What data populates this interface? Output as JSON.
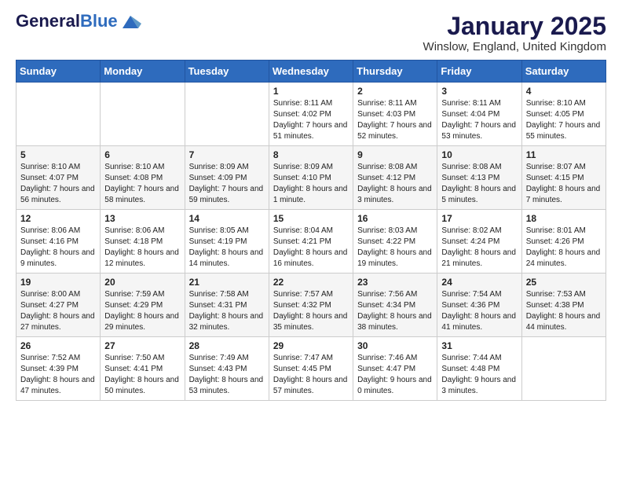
{
  "header": {
    "logo_general": "General",
    "logo_blue": "Blue",
    "month_title": "January 2025",
    "location": "Winslow, England, United Kingdom"
  },
  "weekdays": [
    "Sunday",
    "Monday",
    "Tuesday",
    "Wednesday",
    "Thursday",
    "Friday",
    "Saturday"
  ],
  "weeks": [
    [
      {
        "day": "",
        "info": ""
      },
      {
        "day": "",
        "info": ""
      },
      {
        "day": "",
        "info": ""
      },
      {
        "day": "1",
        "info": "Sunrise: 8:11 AM\nSunset: 4:02 PM\nDaylight: 7 hours and 51 minutes."
      },
      {
        "day": "2",
        "info": "Sunrise: 8:11 AM\nSunset: 4:03 PM\nDaylight: 7 hours and 52 minutes."
      },
      {
        "day": "3",
        "info": "Sunrise: 8:11 AM\nSunset: 4:04 PM\nDaylight: 7 hours and 53 minutes."
      },
      {
        "day": "4",
        "info": "Sunrise: 8:10 AM\nSunset: 4:05 PM\nDaylight: 7 hours and 55 minutes."
      }
    ],
    [
      {
        "day": "5",
        "info": "Sunrise: 8:10 AM\nSunset: 4:07 PM\nDaylight: 7 hours and 56 minutes."
      },
      {
        "day": "6",
        "info": "Sunrise: 8:10 AM\nSunset: 4:08 PM\nDaylight: 7 hours and 58 minutes."
      },
      {
        "day": "7",
        "info": "Sunrise: 8:09 AM\nSunset: 4:09 PM\nDaylight: 7 hours and 59 minutes."
      },
      {
        "day": "8",
        "info": "Sunrise: 8:09 AM\nSunset: 4:10 PM\nDaylight: 8 hours and 1 minute."
      },
      {
        "day": "9",
        "info": "Sunrise: 8:08 AM\nSunset: 4:12 PM\nDaylight: 8 hours and 3 minutes."
      },
      {
        "day": "10",
        "info": "Sunrise: 8:08 AM\nSunset: 4:13 PM\nDaylight: 8 hours and 5 minutes."
      },
      {
        "day": "11",
        "info": "Sunrise: 8:07 AM\nSunset: 4:15 PM\nDaylight: 8 hours and 7 minutes."
      }
    ],
    [
      {
        "day": "12",
        "info": "Sunrise: 8:06 AM\nSunset: 4:16 PM\nDaylight: 8 hours and 9 minutes."
      },
      {
        "day": "13",
        "info": "Sunrise: 8:06 AM\nSunset: 4:18 PM\nDaylight: 8 hours and 12 minutes."
      },
      {
        "day": "14",
        "info": "Sunrise: 8:05 AM\nSunset: 4:19 PM\nDaylight: 8 hours and 14 minutes."
      },
      {
        "day": "15",
        "info": "Sunrise: 8:04 AM\nSunset: 4:21 PM\nDaylight: 8 hours and 16 minutes."
      },
      {
        "day": "16",
        "info": "Sunrise: 8:03 AM\nSunset: 4:22 PM\nDaylight: 8 hours and 19 minutes."
      },
      {
        "day": "17",
        "info": "Sunrise: 8:02 AM\nSunset: 4:24 PM\nDaylight: 8 hours and 21 minutes."
      },
      {
        "day": "18",
        "info": "Sunrise: 8:01 AM\nSunset: 4:26 PM\nDaylight: 8 hours and 24 minutes."
      }
    ],
    [
      {
        "day": "19",
        "info": "Sunrise: 8:00 AM\nSunset: 4:27 PM\nDaylight: 8 hours and 27 minutes."
      },
      {
        "day": "20",
        "info": "Sunrise: 7:59 AM\nSunset: 4:29 PM\nDaylight: 8 hours and 29 minutes."
      },
      {
        "day": "21",
        "info": "Sunrise: 7:58 AM\nSunset: 4:31 PM\nDaylight: 8 hours and 32 minutes."
      },
      {
        "day": "22",
        "info": "Sunrise: 7:57 AM\nSunset: 4:32 PM\nDaylight: 8 hours and 35 minutes."
      },
      {
        "day": "23",
        "info": "Sunrise: 7:56 AM\nSunset: 4:34 PM\nDaylight: 8 hours and 38 minutes."
      },
      {
        "day": "24",
        "info": "Sunrise: 7:54 AM\nSunset: 4:36 PM\nDaylight: 8 hours and 41 minutes."
      },
      {
        "day": "25",
        "info": "Sunrise: 7:53 AM\nSunset: 4:38 PM\nDaylight: 8 hours and 44 minutes."
      }
    ],
    [
      {
        "day": "26",
        "info": "Sunrise: 7:52 AM\nSunset: 4:39 PM\nDaylight: 8 hours and 47 minutes."
      },
      {
        "day": "27",
        "info": "Sunrise: 7:50 AM\nSunset: 4:41 PM\nDaylight: 8 hours and 50 minutes."
      },
      {
        "day": "28",
        "info": "Sunrise: 7:49 AM\nSunset: 4:43 PM\nDaylight: 8 hours and 53 minutes."
      },
      {
        "day": "29",
        "info": "Sunrise: 7:47 AM\nSunset: 4:45 PM\nDaylight: 8 hours and 57 minutes."
      },
      {
        "day": "30",
        "info": "Sunrise: 7:46 AM\nSunset: 4:47 PM\nDaylight: 9 hours and 0 minutes."
      },
      {
        "day": "31",
        "info": "Sunrise: 7:44 AM\nSunset: 4:48 PM\nDaylight: 9 hours and 3 minutes."
      },
      {
        "day": "",
        "info": ""
      }
    ]
  ]
}
